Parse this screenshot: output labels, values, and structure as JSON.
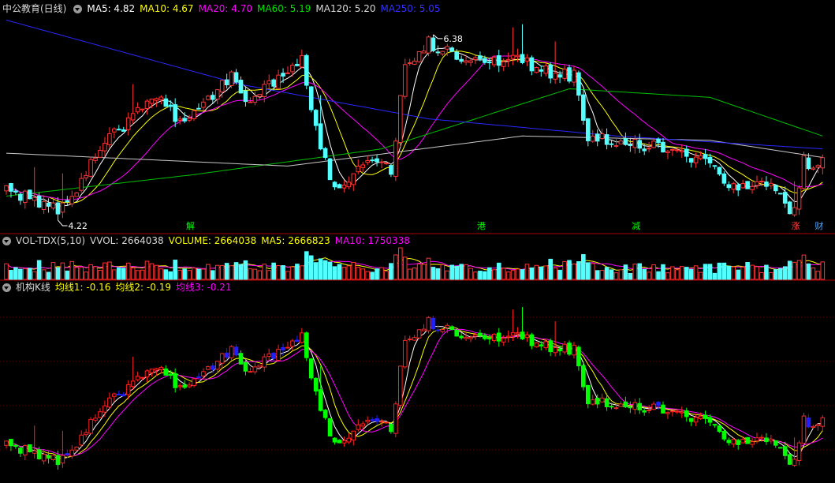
{
  "panels": {
    "price": {
      "title": "中公教育(日线)",
      "ma": [
        {
          "label": "MA5: 4.82",
          "color": "#ffffff"
        },
        {
          "label": "MA10: 4.67",
          "color": "#ffff00"
        },
        {
          "label": "MA20: 4.70",
          "color": "#ff00ff"
        },
        {
          "label": "MA60: 5.19",
          "color": "#00e000"
        },
        {
          "label": "MA120: 5.20",
          "color": "#d8d8d8"
        },
        {
          "label": "MA250: 5.05",
          "color": "#3030ff"
        }
      ],
      "high_label": "6.38",
      "low_label": "4.22"
    },
    "volume": {
      "items": [
        {
          "label": "VOL-TDX(5,10)",
          "color": "#d8d8d8"
        },
        {
          "label": "VVOL: 2664038",
          "color": "#d8d8d8"
        },
        {
          "label": "VOLUME: 2664038",
          "color": "#ffff00"
        },
        {
          "label": "MA5: 2666823",
          "color": "#ffff00"
        },
        {
          "label": "MA10: 1750338",
          "color": "#ff00ff"
        }
      ]
    },
    "inst": {
      "items": [
        {
          "label": "机构K线",
          "color": "#d8d8d8"
        },
        {
          "label": "均线1: -0.16",
          "color": "#ffff00"
        },
        {
          "label": "均线2: -0.19",
          "color": "#ffff00"
        },
        {
          "label": "均线3: -0.21",
          "color": "#ff00ff"
        }
      ]
    }
  },
  "events": [
    {
      "label": "解",
      "color": "#00ff00"
    },
    {
      "label": "港",
      "color": "#00ff00"
    },
    {
      "label": "减",
      "color": "#00ff00"
    },
    {
      "label": "涨",
      "color": "#ff4040"
    },
    {
      "label": "财",
      "color": "#4da6ff"
    }
  ],
  "colors": {
    "up": "#ff3232",
    "down": "#54ffff",
    "inst_up": "#ff2020",
    "inst_down": "#00ff00",
    "inst_blue": "#2020ff",
    "grid": "#8b0000"
  },
  "chart_data": {
    "type": "candlestick",
    "count": 175,
    "key_points": [
      {
        "day": 0,
        "close": 4.55
      },
      {
        "day": 12,
        "close": 4.35
      },
      {
        "day": 20,
        "close": 5.05
      },
      {
        "day": 32,
        "close": 5.7
      },
      {
        "day": 38,
        "close": 5.3
      },
      {
        "day": 48,
        "close": 5.9
      },
      {
        "day": 52,
        "close": 5.6
      },
      {
        "day": 58,
        "close": 5.85
      },
      {
        "day": 63,
        "close": 6.1
      },
      {
        "day": 66,
        "close": 5.25
      },
      {
        "day": 70,
        "close": 4.55
      },
      {
        "day": 78,
        "close": 4.9
      },
      {
        "day": 82,
        "close": 4.8
      },
      {
        "day": 85,
        "close": 6.0
      },
      {
        "day": 90,
        "close": 6.3
      },
      {
        "day": 96,
        "close": 6.1
      },
      {
        "day": 102,
        "close": 6.05
      },
      {
        "day": 108,
        "close": 6.15
      },
      {
        "day": 114,
        "close": 5.95
      },
      {
        "day": 121,
        "close": 5.9
      },
      {
        "day": 124,
        "close": 5.2
      },
      {
        "day": 132,
        "close": 5.1
      },
      {
        "day": 140,
        "close": 5.05
      },
      {
        "day": 148,
        "close": 4.9
      },
      {
        "day": 156,
        "close": 4.6
      },
      {
        "day": 161,
        "close": 4.75
      },
      {
        "day": 168,
        "close": 4.3
      },
      {
        "day": 170,
        "close": 4.9
      },
      {
        "day": 172,
        "close": 4.75
      },
      {
        "day": 174,
        "close": 5.0
      }
    ],
    "ma250_x": [
      0,
      50,
      90,
      130,
      174
    ],
    "ma250_y": [
      6.55,
      5.8,
      5.4,
      5.2,
      5.05
    ],
    "ma120_x": [
      0,
      60,
      110,
      150,
      174
    ],
    "ma120_y": [
      5.0,
      4.85,
      5.2,
      5.15,
      4.95
    ],
    "ma60_x": [
      0,
      40,
      80,
      120,
      150,
      174
    ],
    "ma60_y": [
      4.5,
      4.75,
      5.05,
      5.75,
      5.65,
      5.2
    ],
    "price_range": [
      4.1,
      6.6
    ],
    "high": {
      "day": 91,
      "value": 6.38
    },
    "low": {
      "day": 11,
      "value": 4.22
    },
    "event_days": [
      39,
      101,
      134,
      168,
      173
    ]
  }
}
